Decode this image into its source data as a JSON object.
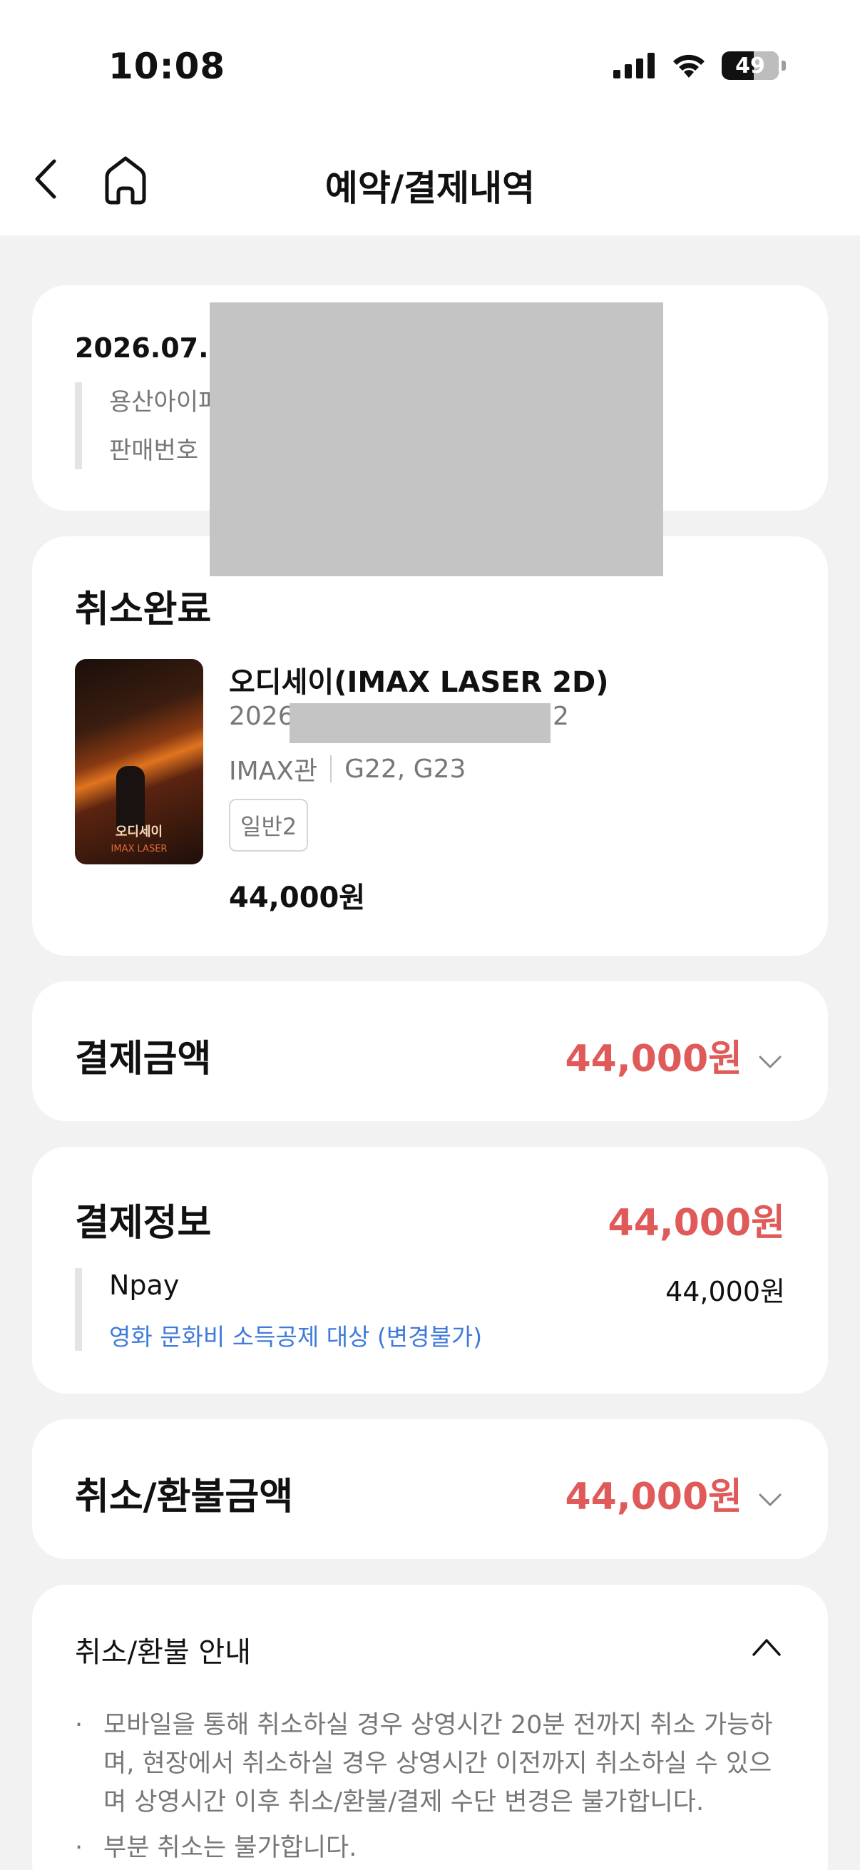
{
  "status_bar": {
    "time": "10:08",
    "battery": "49"
  },
  "header": {
    "title": "예약/결제내역"
  },
  "booking": {
    "date": "2026.07.2",
    "theater": "용산아이파",
    "sale_label": "판매번호"
  },
  "ticket": {
    "status": "취소완료",
    "poster_title": "오디세이",
    "poster_sub": "IMAX LASER",
    "movie_title": "오디세이(IMAX LASER 2D)",
    "date_start": "2026",
    "date_end": "2",
    "hall": "IMAX관",
    "seats": "G22, G23",
    "tag": "일반2",
    "price": "44,000원"
  },
  "payment_amount": {
    "label": "결제금액",
    "amount": "44,000원"
  },
  "payment_info": {
    "label": "결제정보",
    "amount": "44,000원",
    "method": "Npay",
    "method_amount": "44,000원",
    "note": "영화 문화비 소득공제 대상 (변경불가)"
  },
  "refund_amount": {
    "label": "취소/환불금액",
    "amount": "44,000원"
  },
  "refund_guide": {
    "title": "취소/환불 안내",
    "items": [
      "모바일을 통해 취소하실 경우 상영시간 20분 전까지 취소 가능하며, 현장에서 취소하실 경우 상영시간 이전까지 취소하실 수 있으며 상영시간 이후 취소/환불/결제 수단 변경은 불가합니다.",
      "부분 취소는 불가합니다."
    ]
  },
  "colors": {
    "accent_red": "#e05a5a",
    "link_blue": "#3f7bd9"
  },
  "icons": [
    "signal-icon",
    "wifi-icon",
    "battery-icon",
    "back-icon",
    "home-icon",
    "chevron-down-icon",
    "chevron-up-icon"
  ]
}
